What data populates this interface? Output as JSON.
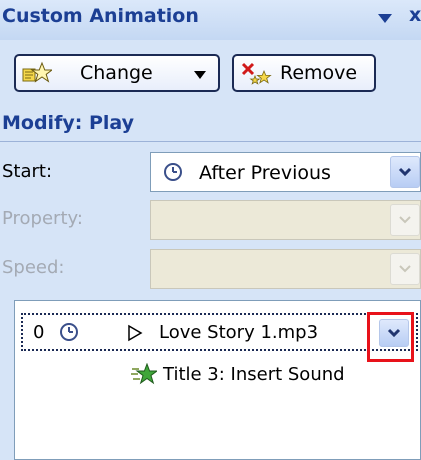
{
  "panel": {
    "title": "Custom Animation",
    "title_menu_icon": "dropdown-arrow-icon",
    "close_label": "x"
  },
  "toolbar": {
    "change_label": "Change",
    "remove_label": "Remove"
  },
  "modify": {
    "section_title": "Modify: Play",
    "start_label": "Start:",
    "start_value": "After Previous",
    "property_label": "Property:",
    "speed_label": "Speed:"
  },
  "animation_list": {
    "items": [
      {
        "order": "0",
        "trigger_icon": "clock-icon",
        "effect_icon": "play-icon",
        "name": "Love Story 1.mp3",
        "selected": true
      },
      {
        "order": "",
        "effect_icon": "star-icon",
        "name": "Title 3: Insert Sound",
        "selected": false
      }
    ]
  },
  "colors": {
    "panel_bg": "#d6e4f7",
    "title_text": "#1c3f94",
    "highlight_box": "#e8121a"
  }
}
